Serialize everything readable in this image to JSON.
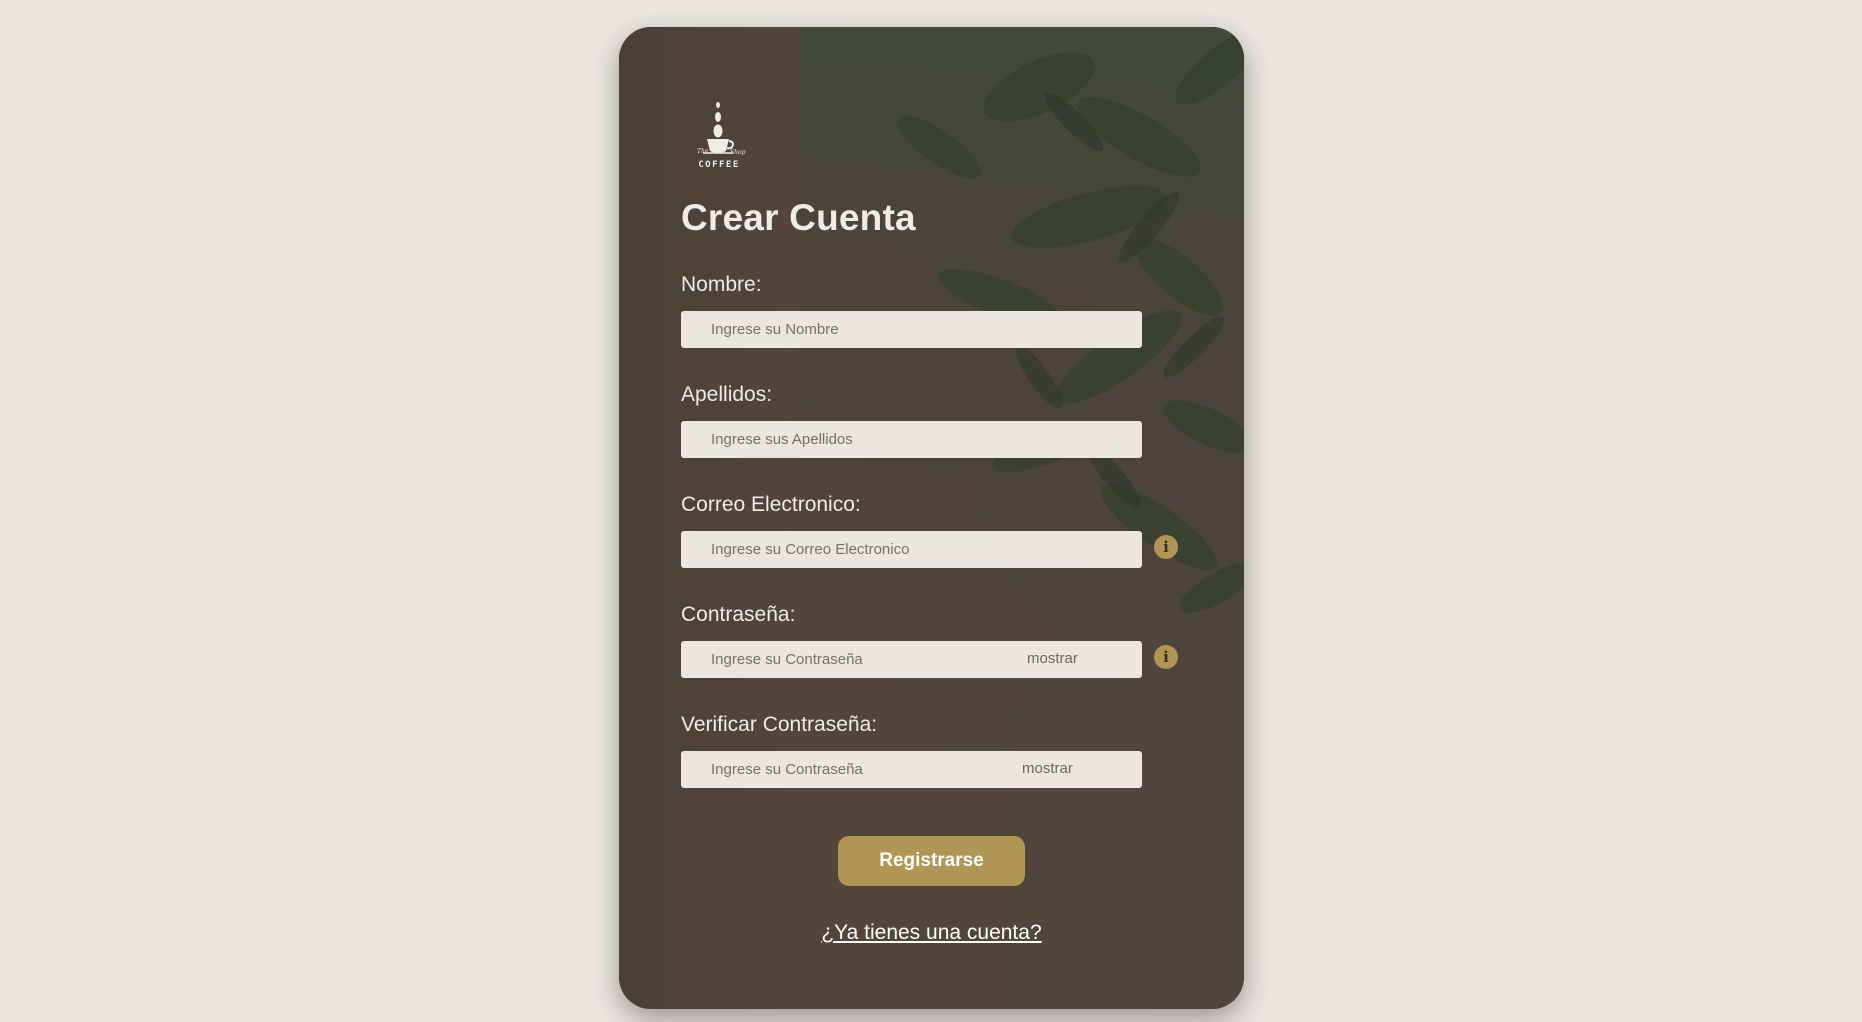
{
  "logo": {
    "line1": "The",
    "line2": "Shop",
    "line3": "COFFEE"
  },
  "form": {
    "title": "Crear Cuenta",
    "fields": [
      {
        "label": "Nombre:",
        "placeholder": "Ingrese su Nombre",
        "value": ""
      },
      {
        "label": "Apellidos:",
        "placeholder": "Ingrese sus Apellidos",
        "value": ""
      },
      {
        "label": "Correo Electronico:",
        "placeholder": "Ingrese su Correo Electronico",
        "value": "",
        "info_icon": "info-icon"
      },
      {
        "label": "Contraseña:",
        "placeholder": "Ingrese su Contraseña",
        "value": "",
        "toggle": "mostrar",
        "info_icon": "info-icon"
      },
      {
        "label": "Verificar Contraseña:",
        "placeholder": "Ingrese su Contraseña",
        "value": "",
        "toggle": "mostrar"
      }
    ],
    "info_glyph": "i",
    "submit_label": "Registrarse",
    "login_link": "¿Ya tienes una cuenta?"
  },
  "colors": {
    "page_bg": "#ebe6e0",
    "card_bg": "#4a4037",
    "accent": "#b09555",
    "text_light": "#f0ebe5",
    "input_bg": "#ebe6e0"
  }
}
